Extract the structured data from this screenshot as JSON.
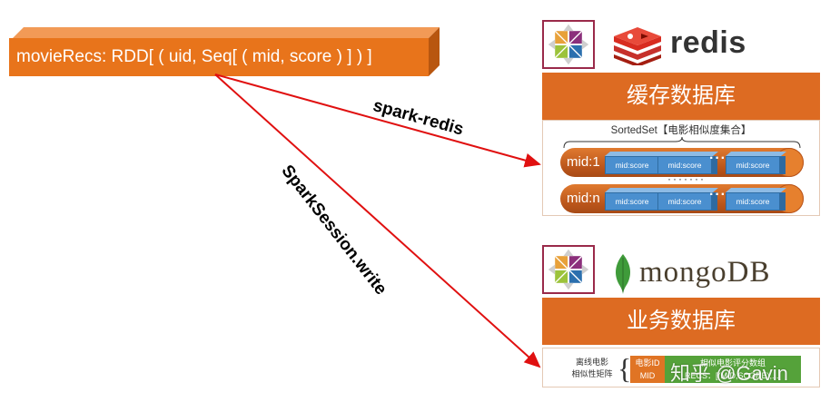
{
  "rdd": {
    "text": "movieRecs: RDD[ ( uid, Seq[ ( mid, score ) ] ) ]"
  },
  "arrows": {
    "redis_label": "spark-redis",
    "mongo_label": "SparkSession.write",
    "color": "#e01010"
  },
  "redis": {
    "logo_text": "redis",
    "header": "缓存数据库",
    "sorted_set_title": "SortedSet【电影相似度集合】",
    "rows": [
      {
        "label": "mid:1",
        "cells": [
          "mid:score",
          "mid:score",
          "mid:score"
        ],
        "ellipsis": "···"
      },
      {
        "label": "mid:n",
        "cells": [
          "mid:score",
          "mid:score",
          "mid:score"
        ],
        "ellipsis": "···"
      }
    ],
    "vertical_dots": "·······"
  },
  "mongo": {
    "logo_text": "mongoDB",
    "header": "业务数据库",
    "desc_line1": "离线电影",
    "desc_line2": "相似性矩阵",
    "brace": "{",
    "mid_line1": "电影ID",
    "mid_line2": "MID",
    "group_line1": "相似电影评分数组",
    "group_line2": "RECS：[(MID,SCORE),...]"
  },
  "watermark": "知乎 @Gavin",
  "colors": {
    "orange": "#dd6b22",
    "cube_blue": "#4a8fcf",
    "redis_red": "#d82c20",
    "mongo_green": "#3f9b3a",
    "centos_border": "#9a2a4a"
  }
}
